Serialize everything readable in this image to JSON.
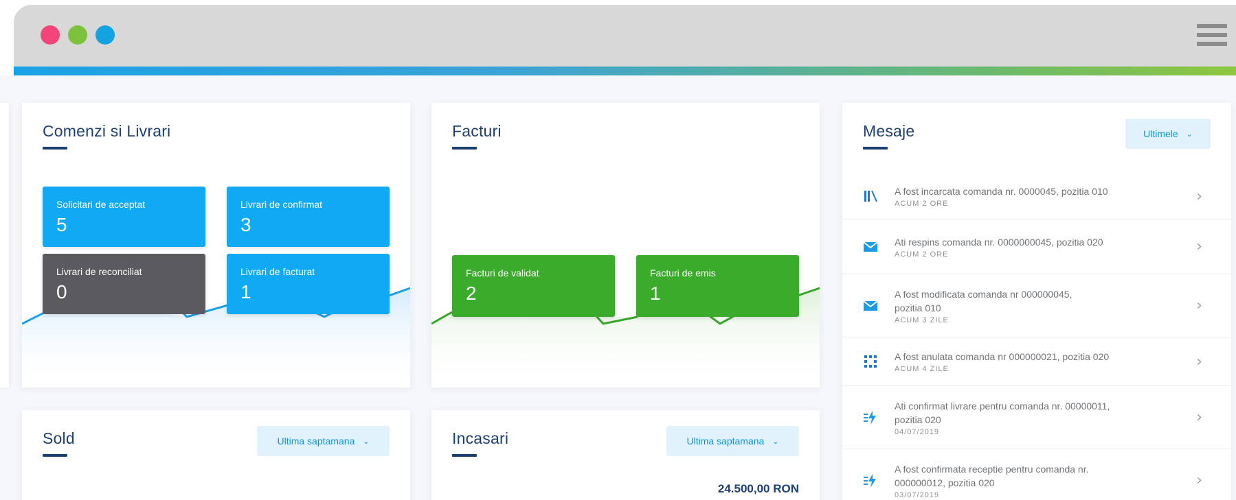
{
  "window": {
    "dot_colors": [
      "#f2457a",
      "#7cc23a",
      "#14a3e2"
    ]
  },
  "orders_card": {
    "title": "Comenzi si Livrari",
    "tiles": [
      {
        "label": "Solicitari de acceptat",
        "value": "5",
        "color": "#0faaf3"
      },
      {
        "label": "Livrari de confirmat",
        "value": "3",
        "color": "#0faaf3"
      },
      {
        "label": "Livrari de reconciliat",
        "value": "0",
        "color": "#5b5a5f"
      },
      {
        "label": "Livrari de facturat",
        "value": "1",
        "color": "#0faaf3"
      }
    ]
  },
  "invoices_card": {
    "title": "Facturi",
    "tiles": [
      {
        "label": "Facturi de validat",
        "value": "2",
        "color": "#3aab2a"
      },
      {
        "label": "Facturi de emis",
        "value": "1",
        "color": "#3aab2a"
      }
    ]
  },
  "messages_card": {
    "title": "Mesaje",
    "filter": "Ultimele",
    "items": [
      {
        "lines": [
          "A fost incarcata comanda nr. 0000045, pozitia 010"
        ],
        "time": "ACUM 2 ORE",
        "icon": "document-bars-icon"
      },
      {
        "lines": [
          "Ati respins comanda nr. 0000000045, pozitia 020"
        ],
        "time": "ACUM 2 ORE",
        "icon": "envelope-icon"
      },
      {
        "lines": [
          "A fost modificata comanda nr 000000045,",
          "pozitia 010"
        ],
        "time": "ACUM 3 ZILE",
        "icon": "envelope-icon"
      },
      {
        "lines": [
          "A fost anulata comanda nr 000000021, pozitia 020"
        ],
        "time": "ACUM 4 ZILE",
        "icon": "dotted-box-icon"
      },
      {
        "lines": [
          "Ati confirmat livrare pentru comanda nr. 00000011,",
          "pozitia 020"
        ],
        "time": "04/07/2019",
        "icon": "lightning-icon"
      },
      {
        "lines": [
          "A fost confirmata receptie pentru comanda nr.",
          "000000012, pozitia 020"
        ],
        "time": "03/07/2019",
        "icon": "lightning-icon"
      }
    ]
  },
  "balance_card": {
    "title": "Sold",
    "filter": "Ultima saptamana"
  },
  "receipts_card": {
    "title": "Incasari",
    "filter": "Ultima saptamana",
    "amount": "24.500,00 RON"
  }
}
